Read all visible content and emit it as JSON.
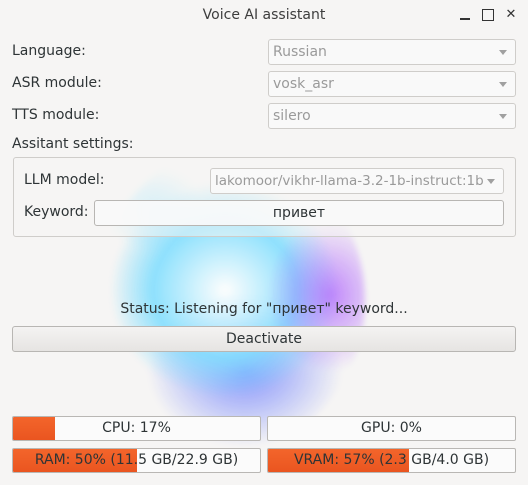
{
  "window": {
    "title": "Voice AI assistant"
  },
  "settings": {
    "language": {
      "label": "Language:",
      "value": "Russian"
    },
    "asr": {
      "label": "ASR module:",
      "value": "vosk_asr"
    },
    "tts": {
      "label": "TTS module:",
      "value": "silero"
    },
    "assistant_label": "Assitant settings:",
    "llm": {
      "label": "LLM model:",
      "value": "lakomoor/vikhr-llama-3.2-1b-instruct:1b"
    },
    "keyword": {
      "label": "Keyword:",
      "value": "привет"
    }
  },
  "status_text": "Status: Listening for \"привет\" keyword...",
  "deactivate_label": "Deactivate",
  "meters": {
    "cpu": {
      "text": "CPU: 17%",
      "percent": 17
    },
    "gpu": {
      "text": "GPU: 0%",
      "percent": 0
    },
    "ram": {
      "text": "RAM: 50% (11.5 GB/22.9 GB)",
      "percent": 50
    },
    "vram": {
      "text": "VRAM: 57% (2.3 GB/4.0 GB)",
      "percent": 57
    }
  },
  "colors": {
    "accent": "#ea5520"
  },
  "icons": {
    "minimize": "minimize-icon",
    "maximize": "maximize-icon",
    "close": "close-icon"
  }
}
